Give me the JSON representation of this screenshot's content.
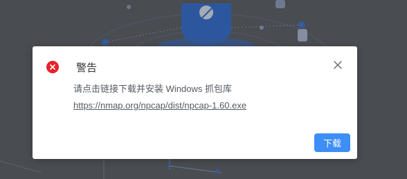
{
  "dialog": {
    "title": "警告",
    "message": "请点击链接下载并安装 Windows 抓包库",
    "link": "https://nmap.org/npcap/dist/npcap-1.60.exe",
    "download_label": "下载"
  },
  "icons": {
    "error": "error-circle-icon",
    "close": "close-icon"
  },
  "colors": {
    "error": "#e8222c",
    "primary": "#3d8ef5",
    "backdrop": "#5b5e63"
  }
}
